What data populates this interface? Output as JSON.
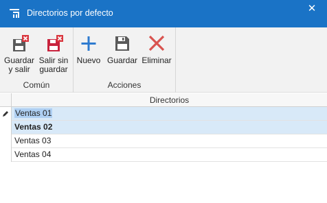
{
  "window": {
    "title": "Directorios por defecto",
    "icon": "app-bars-icon",
    "close_glyph": "✕",
    "accent": "#1a73c6"
  },
  "ribbon": {
    "groups": [
      {
        "label": "Común",
        "buttons": [
          {
            "line1": "Guardar",
            "line2": "y salir",
            "icon": "save-close-icon"
          },
          {
            "line1": "Salir sin",
            "line2": "guardar",
            "icon": "exit-without-save-icon"
          }
        ]
      },
      {
        "label": "Acciones",
        "buttons": [
          {
            "line1": "Nuevo",
            "icon": "plus-icon"
          },
          {
            "line1": "Guardar",
            "icon": "save-icon"
          },
          {
            "line1": "Eliminar",
            "icon": "delete-x-icon"
          }
        ]
      }
    ]
  },
  "grid": {
    "column_header": "Directorios",
    "rows": [
      "Ventas 01",
      "Ventas 02",
      "Ventas 03",
      "Ventas 04"
    ],
    "editing_row": 0,
    "selection_color": "#d8e9f8"
  }
}
